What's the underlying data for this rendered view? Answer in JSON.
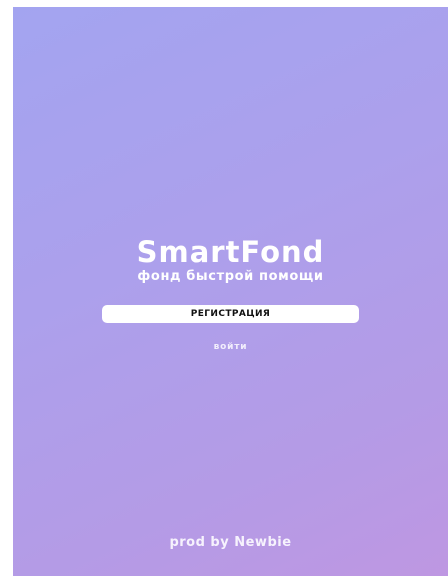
{
  "app": {
    "title": "SmartFond",
    "tagline": "фонд быстрой помощи"
  },
  "actions": {
    "register_label": "РЕГИСТРАЦИЯ",
    "login_label": "войти"
  },
  "footer": {
    "credit": "prod by Newbie"
  },
  "colors": {
    "gradient_start": "#a3a4f0",
    "gradient_end": "#be97e2",
    "button_bg": "#ffffff",
    "text": "#ffffff"
  }
}
